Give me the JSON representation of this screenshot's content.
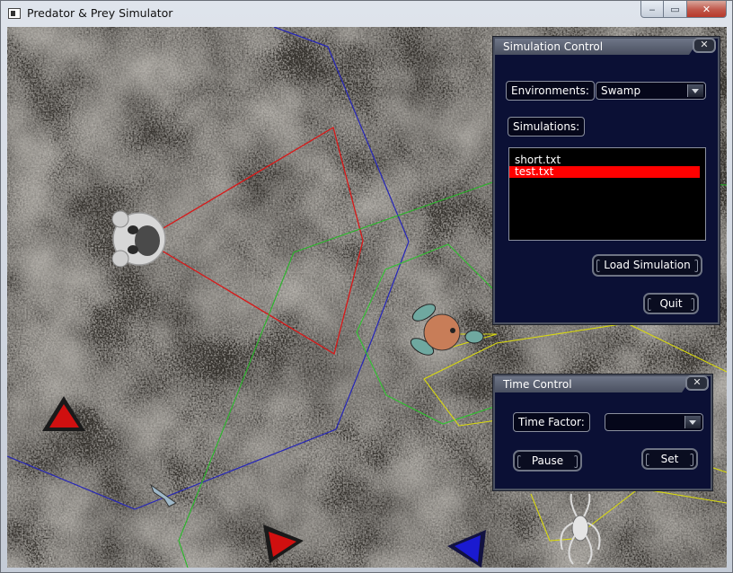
{
  "window": {
    "title": "Predator & Prey Simulator",
    "minimize": "‒",
    "maximize": "▭",
    "close": "✕"
  },
  "simulation_control": {
    "title": "Simulation Control",
    "close": "✕",
    "environments_label": "Environments:",
    "environment_selected": "Swamp",
    "simulations_label": "Simulations:",
    "simulations": [
      "short.txt",
      "test.txt"
    ],
    "selected_simulation": "test.txt",
    "load_button": "Load Simulation",
    "quit_button": "Quit"
  },
  "time_control": {
    "title": "Time Control",
    "close": "✕",
    "time_factor_label": "Time Factor:",
    "time_factor_value": "",
    "pause_button": "Pause",
    "set_button": "Set"
  },
  "icons": [
    "panda-creature",
    "rabbit-creature",
    "spider-creature",
    "arrow-creature",
    "red-triangle-marker",
    "blue-triangle-marker"
  ],
  "colors": {
    "panel_bg": "#0b1035",
    "selection": "#ff0000",
    "vision_red": "#e01616",
    "vision_blue": "#2020c0",
    "vision_green": "#22cc22",
    "vision_yellow": "#e0e010"
  }
}
